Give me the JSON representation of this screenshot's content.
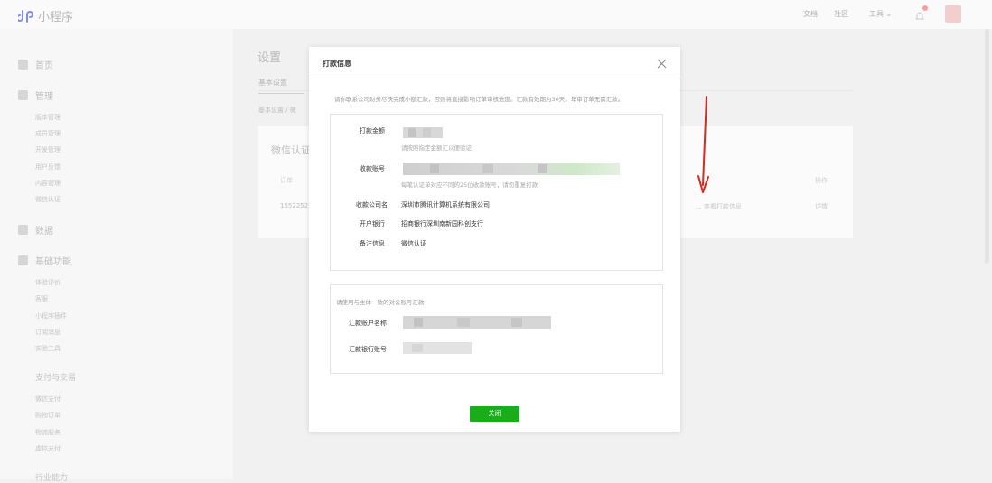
{
  "app": {
    "name": "小程序"
  },
  "topbar": {
    "docs": "文档",
    "community": "社区",
    "tools": "工具"
  },
  "sidebar": {
    "home": "首页",
    "manage": "管理",
    "manage_items": [
      "版本管理",
      "成员管理",
      "开发管理",
      "用户反馈",
      "内容管理",
      "微信认证"
    ],
    "data": "数据",
    "basic": "基础功能",
    "basic_items": [
      "体验评价",
      "客服",
      "小程序插件",
      "订阅消息",
      "实验工具"
    ],
    "pay_group": "支付与交易",
    "pay_items": [
      "微信支付",
      "购物订单",
      "物流服务",
      "虚拟支付"
    ],
    "industry": "行业能力"
  },
  "main": {
    "title": "设置",
    "tab": "基本设置",
    "card_title": "微信认证",
    "id_fragment": "15522527",
    "col_action": "操作",
    "action": "详情",
    "mid_text": "... 查看打款信息"
  },
  "dialog": {
    "title": "打款信息",
    "notice": "请你联系公司财务尽快完成小额汇款，否则将直接影响订单审核进度。汇款有效期为30天，年审订单无需汇款。",
    "amount_label": "打款金额",
    "amount_hint": "请按照指定金额汇以便验证",
    "account_label": "收款账号",
    "account_hint": "每笔认证单对应不同的25位收款账号，请勿重复打款",
    "company_label": "收款公司名",
    "company": "深圳市腾讯计算机系统有限公司",
    "bank_label": "开户银行",
    "bank": "招商银行深圳南新园科创支行",
    "remark_label": "备注信息",
    "remark": "微信认证",
    "payer_notice": "请使用与主体一致的对公账号汇款",
    "payer_name_label": "汇款账户名称",
    "payer_account_label": "汇款银行账号",
    "close_button": "关闭"
  },
  "icons": [
    "miniprogram-logo-icon",
    "bell-icon",
    "close-icon",
    "home-icon",
    "manage-icon",
    "data-icon",
    "basic-icon"
  ],
  "colors": {
    "primary": "#1aad19",
    "annotation_arrow": "#d9281f"
  }
}
